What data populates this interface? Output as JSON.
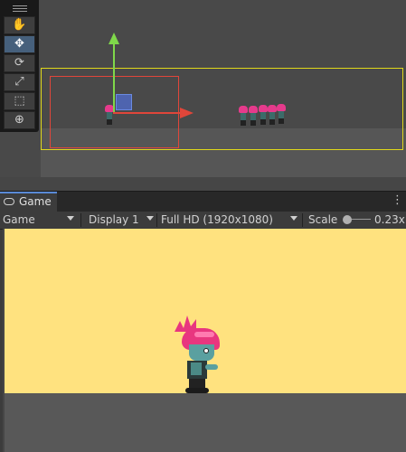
{
  "game_window": {
    "tab_label": "Game",
    "tab_icon": "gamepad-icon",
    "menu_icon": "kebab-menu-icon",
    "menu_glyph": "⋮"
  },
  "game_toolbar": {
    "view_mode": "Game",
    "display": "Display 1",
    "resolution": "Full HD (1920x1080)",
    "scale_label": "Scale",
    "scale_value": "0.23x"
  },
  "scene_tools": [
    {
      "name": "hand-tool",
      "icon": "hand-icon",
      "glyph": "✋",
      "active": false
    },
    {
      "name": "move-tool",
      "icon": "move-icon",
      "glyph": "✥",
      "active": true
    },
    {
      "name": "rotate-tool",
      "icon": "rotate-icon",
      "glyph": "⟳",
      "active": false
    },
    {
      "name": "scale-tool",
      "icon": "scale-icon",
      "glyph": "⤢",
      "active": false
    },
    {
      "name": "rect-tool",
      "icon": "rect-icon",
      "glyph": "⬚",
      "active": false
    },
    {
      "name": "transform-tool",
      "icon": "transform-icon",
      "glyph": "⊕",
      "active": false
    }
  ],
  "colors": {
    "sky": "#ffe27f",
    "camera_bounds": "#e0d81a",
    "selection": "#e0463a",
    "gizmo_y": "#7fd84a",
    "gizmo_x": "#e0463a",
    "zombie_hair": "#e8367f",
    "zombie_skin": "#5aa0a0"
  }
}
